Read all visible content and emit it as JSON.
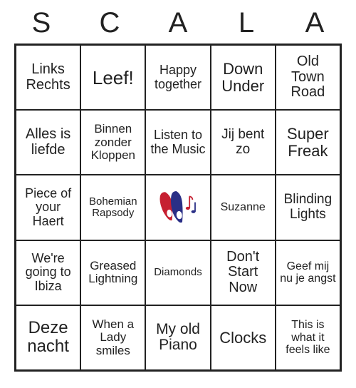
{
  "header": [
    "S",
    "C",
    "A",
    "L",
    "A"
  ],
  "grid": {
    "r1c1": "Links Rechts",
    "r1c2": "Leef!",
    "r1c3": "Happy together",
    "r1c4": "Down Under",
    "r1c5": "Old Town Road",
    "r2c1": "Alles is liefde",
    "r2c2": "Binnen zonder Kloppen",
    "r2c3": "Listen to the Music",
    "r2c4": "Jij bent zo",
    "r2c5": "Super Freak",
    "r3c1": "Piece of your Haert",
    "r3c2": "Bohemian Rapsody",
    "r3c3": "",
    "r3c4": "Suzanne",
    "r3c5": "Blinding Lights",
    "r4c1": "We're going to Ibiza",
    "r4c2": "Greased Lightning",
    "r4c3": "Diamonds",
    "r4c4": "Don't Start Now",
    "r4c5": "Geef mij nu je angst",
    "r5c1": "Deze nacht",
    "r5c2": "When a Lady smiles",
    "r5c3": "My old Piano",
    "r5c4": "Clocks",
    "r5c5": "This is what it feels like"
  },
  "center_icon": "singing-faces-music-notes-icon"
}
